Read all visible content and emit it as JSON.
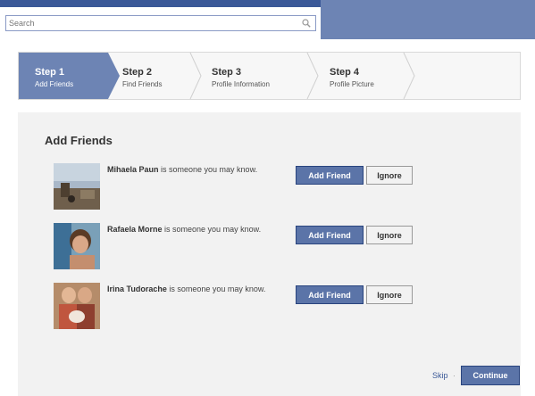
{
  "search": {
    "placeholder": "Search",
    "value": ""
  },
  "steps": [
    {
      "title": "Step 1",
      "subtitle": "Add Friends",
      "active": true
    },
    {
      "title": "Step 2",
      "subtitle": "Find Friends",
      "active": false
    },
    {
      "title": "Step 3",
      "subtitle": "Profile Information",
      "active": false
    },
    {
      "title": "Step 4",
      "subtitle": "Profile Picture",
      "active": false
    }
  ],
  "section": {
    "title": "Add Friends"
  },
  "suggestions": [
    {
      "name": "Mihaela Paun",
      "text": " is someone you may know.",
      "add_label": "Add Friend",
      "ignore_label": "Ignore"
    },
    {
      "name": "Rafaela Morne",
      "text": " is someone you may know.",
      "add_label": "Add Friend",
      "ignore_label": "Ignore"
    },
    {
      "name": "Irina Tudorache",
      "text": " is someone you may know.",
      "add_label": "Add Friend",
      "ignore_label": "Ignore"
    }
  ],
  "footer": {
    "skip_label": "Skip",
    "separator": "·",
    "continue_label": "Continue"
  },
  "colors": {
    "brand": "#3b5998",
    "accent": "#6d84b4",
    "button": "#5b74a8"
  }
}
